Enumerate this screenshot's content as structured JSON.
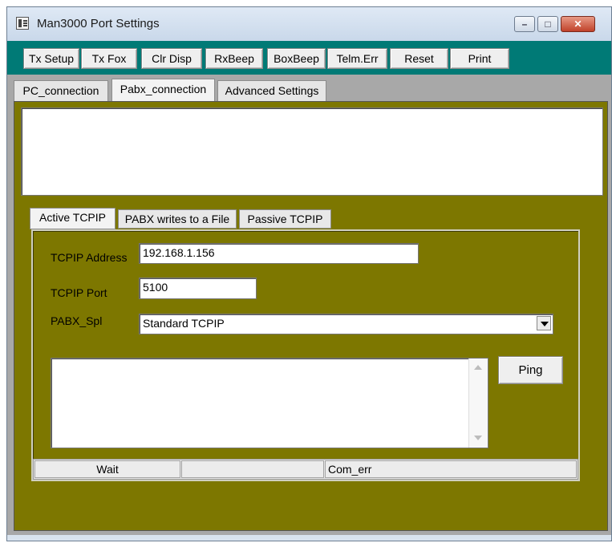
{
  "window": {
    "title": "Man3000 Port Settings"
  },
  "toolbar": {
    "buttons": [
      "Tx Setup",
      "Tx Fox",
      "Clr Disp",
      "RxBeep",
      "BoxBeep",
      "Telm.Err",
      "Reset",
      "Print"
    ]
  },
  "tabs": [
    "PC_connection",
    "Pabx_connection",
    "Advanced Settings"
  ],
  "active_tab": "Pabx_connection",
  "subtabs": [
    "Active TCPIP",
    "PABX writes to a File",
    "Passive TCPIP"
  ],
  "active_subtab": "Active TCPIP",
  "form": {
    "address_label": "TCPIP Address",
    "address_value": "192.168.1.156",
    "port_label": "TCPIP Port",
    "port_value": "5100",
    "spl_label": "PABX_Spl",
    "spl_value": "Standard TCPIP"
  },
  "ping_label": "Ping",
  "status": {
    "left": "Wait",
    "middle": "",
    "right": "Com_err"
  },
  "colors": {
    "toolbar": "#007a76",
    "panel": "#7d7700",
    "frame": "#a8a8a8"
  }
}
